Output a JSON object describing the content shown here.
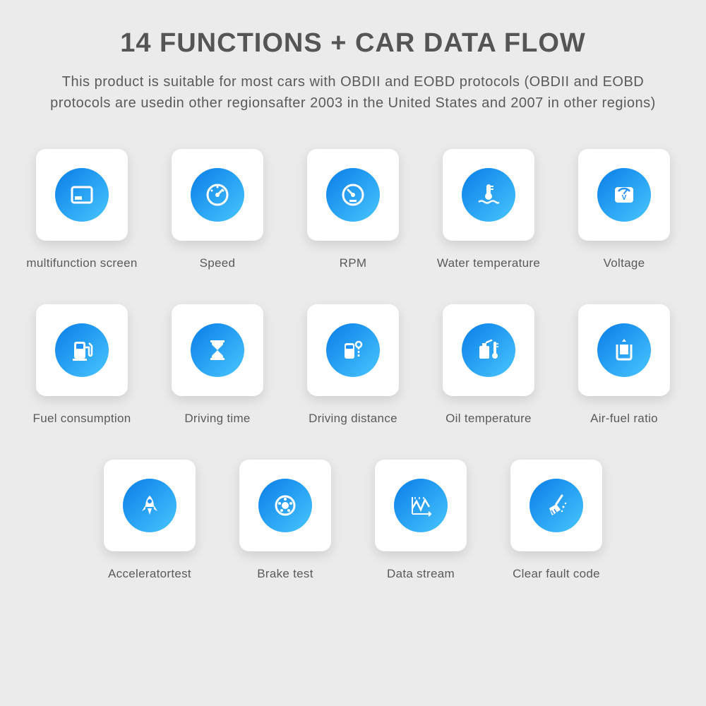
{
  "title": "14 FUNCTIONS + CAR DATA FLOW",
  "subtitle": "This product is suitable for most cars with OBDII and EOBD protocols (OBDII and EOBD protocols are usedin other regionsafter 2003 in the United States and 2007 in other regions)",
  "features": [
    {
      "label": "multifunction screen",
      "icon": "screen-icon"
    },
    {
      "label": "Speed",
      "icon": "gauge-icon"
    },
    {
      "label": "RPM",
      "icon": "gauge-icon"
    },
    {
      "label": "Water temperature",
      "icon": "thermometer-waves-icon"
    },
    {
      "label": "Voltage",
      "icon": "voltage-icon"
    },
    {
      "label": "Fuel consumption",
      "icon": "fuel-pump-icon"
    },
    {
      "label": "Driving time",
      "icon": "hourglass-icon"
    },
    {
      "label": "Driving distance",
      "icon": "distance-icon"
    },
    {
      "label": "Oil temperature",
      "icon": "oil-thermometer-icon"
    },
    {
      "label": "Air-fuel ratio",
      "icon": "container-icon"
    },
    {
      "label": "Acceleratortest",
      "icon": "rocket-icon"
    },
    {
      "label": "Brake test",
      "icon": "brake-icon"
    },
    {
      "label": "Data stream",
      "icon": "waveform-icon"
    },
    {
      "label": "Clear fault code",
      "icon": "broom-icon"
    }
  ],
  "rows": [
    [
      0,
      1,
      2,
      3,
      4
    ],
    [
      5,
      6,
      7,
      8,
      9
    ],
    [
      10,
      11,
      12,
      13
    ]
  ]
}
